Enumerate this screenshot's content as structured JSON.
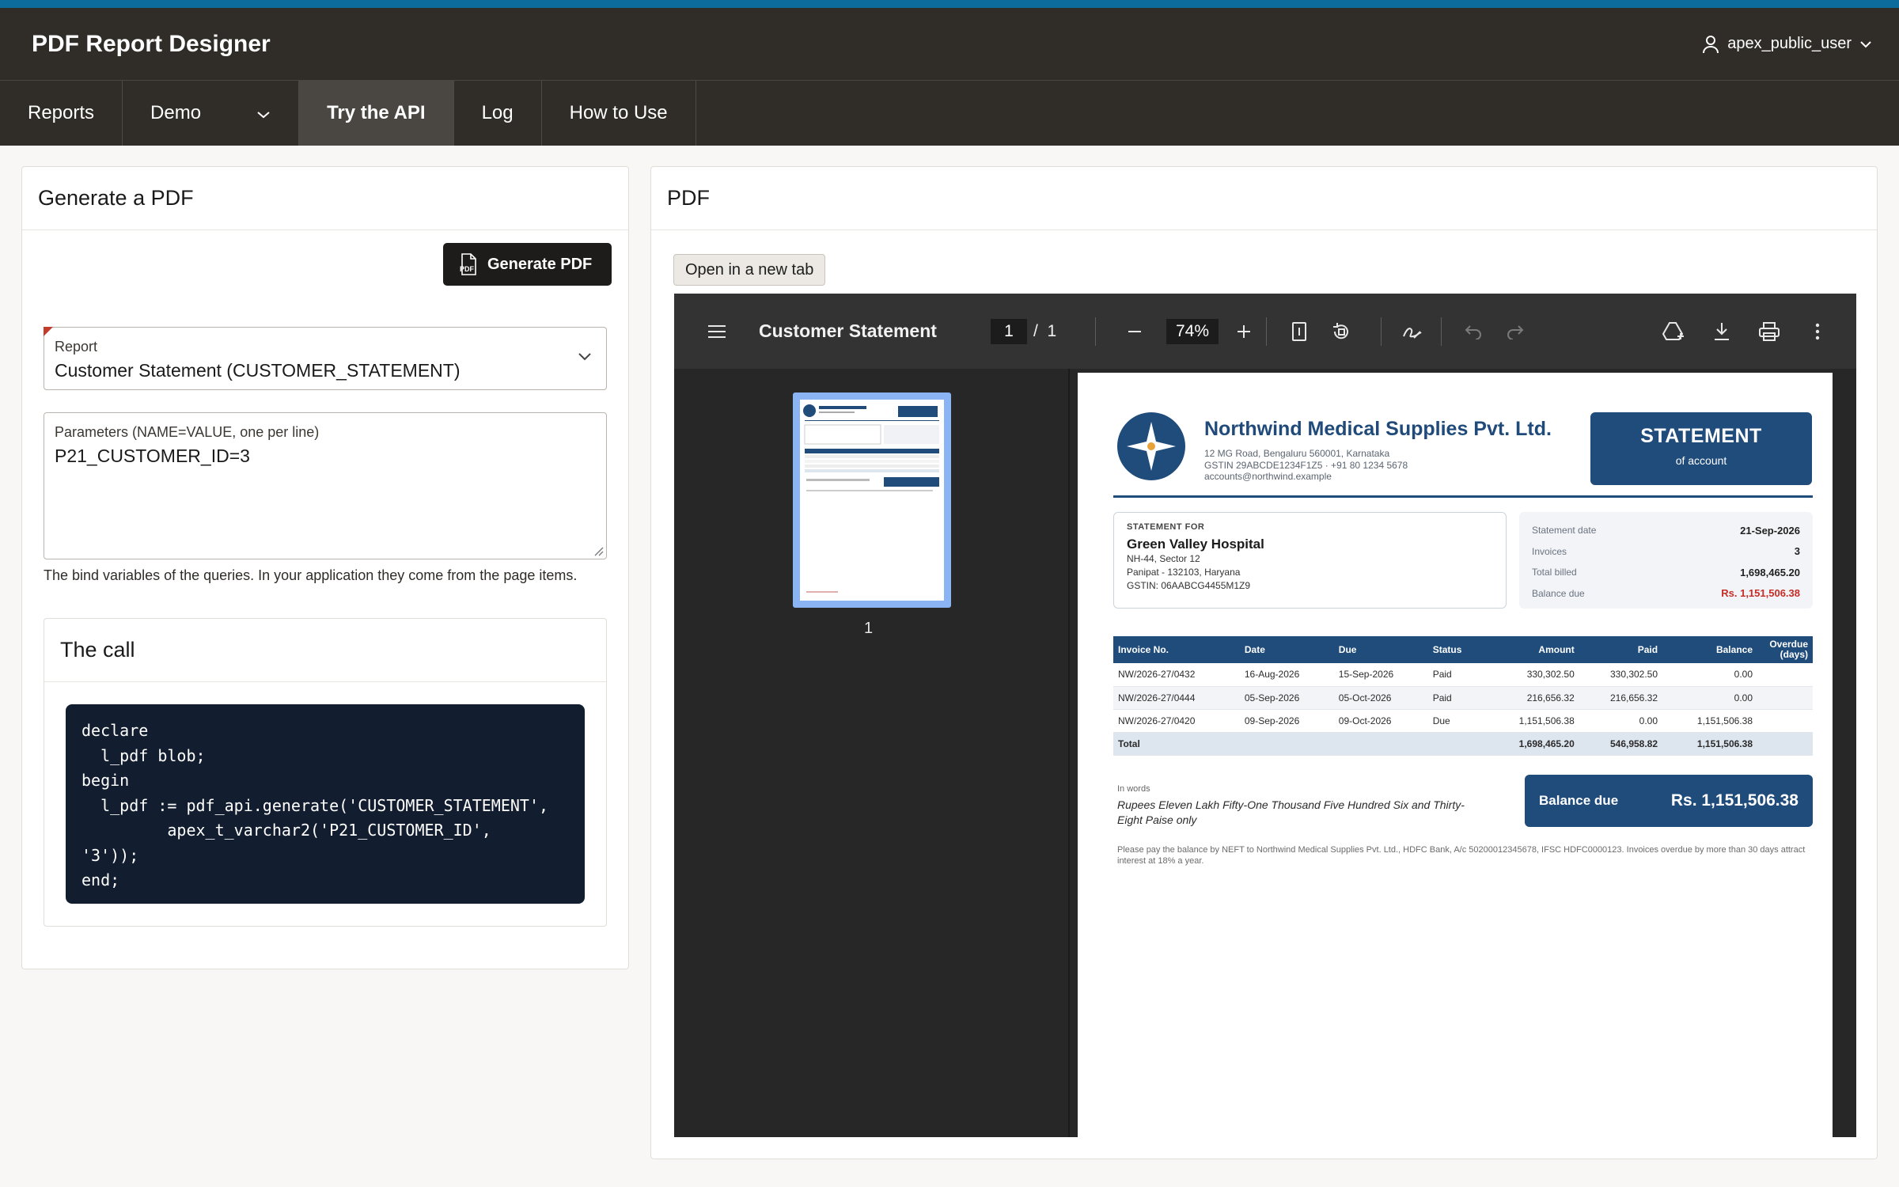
{
  "app": {
    "title": "PDF Report Designer",
    "user": "apex_public_user"
  },
  "nav": {
    "items": [
      "Reports",
      "Demo",
      "Try the API",
      "Log",
      "How to Use"
    ],
    "active": "Try the API"
  },
  "generate_card": {
    "title": "Generate a PDF",
    "button_label": "Generate PDF",
    "report_label": "Report",
    "report_value": "Customer Statement (CUSTOMER_STATEMENT)",
    "params_label": "Parameters (NAME=VALUE, one per line)",
    "params_value": "P21_CUSTOMER_ID=3",
    "help_text": "The bind variables of the queries. In your application they come from the page items.",
    "call_title": "The call",
    "code": "declare\n  l_pdf blob;\nbegin\n  l_pdf := pdf_api.generate('CUSTOMER_STATEMENT',\n         apex_t_varchar2('P21_CUSTOMER_ID',\n'3'));\nend;"
  },
  "pdf_card": {
    "title": "PDF",
    "open_tab_label": "Open in a new tab",
    "viewer": {
      "doc_name": "Customer Statement",
      "page": "1",
      "page_sep": "/",
      "page_count": "1",
      "zoom": "74%",
      "thumb_label": "1"
    }
  },
  "statement": {
    "company": "Northwind Medical Supplies Pvt. Ltd.",
    "address": "12 MG Road, Bengaluru 560001, Karnataka",
    "gstin_phone": "GSTIN 29ABCDE1234F1Z5  ·  +91 80 1234 5678",
    "email": "accounts@northwind.example",
    "badge_title": "STATEMENT",
    "badge_sub": "of account",
    "bill_label": "STATEMENT FOR",
    "customer": "Green Valley Hospital",
    "cust_line1": "NH-44, Sector 12",
    "cust_line2": "Panipat - 132103, Haryana",
    "cust_line3": "GSTIN: 06AABCG4455M1Z9",
    "summary": [
      {
        "k": "Statement date",
        "v": "21-Sep-2026"
      },
      {
        "k": "Invoices",
        "v": "3"
      },
      {
        "k": "Total billed",
        "v": "1,698,465.20"
      },
      {
        "k": "Balance due",
        "v": "Rs. 1,151,506.38"
      }
    ],
    "table_headers": [
      "Invoice No.",
      "Date",
      "Due",
      "Status",
      "Amount",
      "Paid",
      "Balance",
      "Overdue (days)"
    ],
    "rows": [
      [
        "NW/2026-27/0432",
        "16-Aug-2026",
        "15-Sep-2026",
        "Paid",
        "330,302.50",
        "330,302.50",
        "0.00",
        ""
      ],
      [
        "NW/2026-27/0444",
        "05-Sep-2026",
        "05-Oct-2026",
        "Paid",
        "216,656.32",
        "216,656.32",
        "0.00",
        ""
      ],
      [
        "NW/2026-27/0420",
        "09-Sep-2026",
        "09-Oct-2026",
        "Due",
        "1,151,506.38",
        "0.00",
        "1,151,506.38",
        ""
      ]
    ],
    "total_row": [
      "Total",
      "",
      "",
      "",
      "1,698,465.20",
      "546,958.82",
      "1,151,506.38",
      ""
    ],
    "in_words_label": "In words",
    "in_words": "Rupees Eleven Lakh Fifty-One Thousand Five Hundred Six and Thirty-Eight Paise only",
    "balance_label": "Balance due",
    "balance_value": "Rs. 1,151,506.38",
    "footnote": "Please pay the balance by NEFT to Northwind Medical Supplies Pvt. Ltd., HDFC Bank, A/c 50200012345678, IFSC HDFC0000123. Invoices overdue by more than 30 days attract interest at 18% a year."
  },
  "colors": {
    "header_bg": "#302d28",
    "accent": "#0c6d9c",
    "doc_blue": "#204c7c",
    "alert_red": "#c62d26"
  }
}
